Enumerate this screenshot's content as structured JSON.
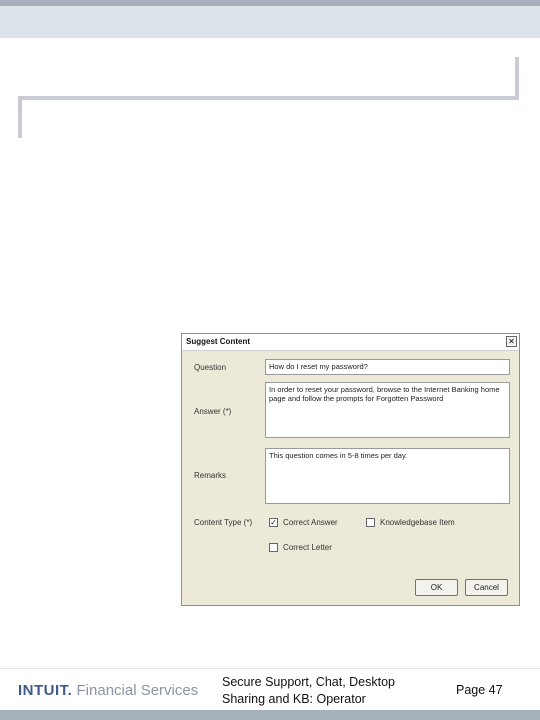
{
  "dialog": {
    "title": "Suggest Content",
    "close_glyph": "✕",
    "question_label": "Question",
    "question_value": "How do I reset my password?",
    "answer_label": "Answer (*)",
    "answer_value": "In order to reset your password, browse to the Internet Banking home page and follow the prompts for Forgotten Password",
    "remarks_label": "Remarks",
    "remarks_value": "This question comes in 5-8 times per day.",
    "content_type_label": "Content Type (*)",
    "options": [
      {
        "label": "Correct Answer",
        "checked": true
      },
      {
        "label": "Knowledgebase Item",
        "checked": false
      },
      {
        "label": "Correct Letter",
        "checked": false
      }
    ],
    "ok_label": "OK",
    "cancel_label": "Cancel"
  },
  "footer": {
    "brand": "INTUIT.",
    "brand_sub": "Financial Services",
    "title": "Secure Support, Chat, Desktop Sharing and KB: Operator",
    "page": "Page 47"
  },
  "colors": {
    "top_band": "#dde3ea",
    "accent_bar": "#a7b1bd",
    "brand": "#3d5a8a"
  }
}
